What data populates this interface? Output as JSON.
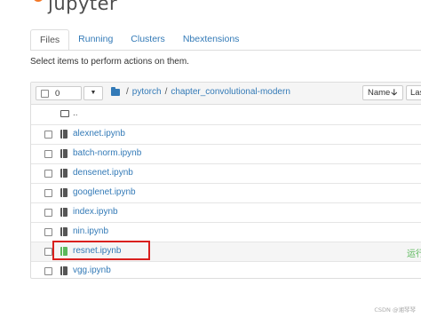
{
  "app": {
    "logo_text": "jupyter"
  },
  "tabs": [
    {
      "label": "Files",
      "active": true
    },
    {
      "label": "Running",
      "active": false
    },
    {
      "label": "Clusters",
      "active": false
    },
    {
      "label": "Nbextensions",
      "active": false
    }
  ],
  "instructions": "Select items to perform actions on them.",
  "toolbar": {
    "selected_count": "0",
    "sort_name": "Name",
    "sort_name_arrow": "🡣",
    "sort_last": "Las"
  },
  "breadcrumb": {
    "root_sep": "/",
    "items": [
      "pytorch",
      "chapter_convolutional-modern"
    ],
    "sep": "/"
  },
  "rows": [
    {
      "name": "..",
      "type": "folder"
    },
    {
      "name": "alexnet.ipynb",
      "type": "notebook"
    },
    {
      "name": "batch-norm.ipynb",
      "type": "notebook"
    },
    {
      "name": "densenet.ipynb",
      "type": "notebook"
    },
    {
      "name": "googlenet.ipynb",
      "type": "notebook"
    },
    {
      "name": "index.ipynb",
      "type": "notebook"
    },
    {
      "name": "nin.ipynb",
      "type": "notebook"
    },
    {
      "name": "resnet.ipynb",
      "type": "notebook",
      "status": "运行",
      "running": true
    },
    {
      "name": "vgg.ipynb",
      "type": "notebook"
    }
  ],
  "colors": {
    "link": "#337ab7",
    "running": "#5cb85c",
    "highlight_box": "#d9201e",
    "logo_orange": "#f37726"
  },
  "watermark": "CSDN @湘琴琴"
}
